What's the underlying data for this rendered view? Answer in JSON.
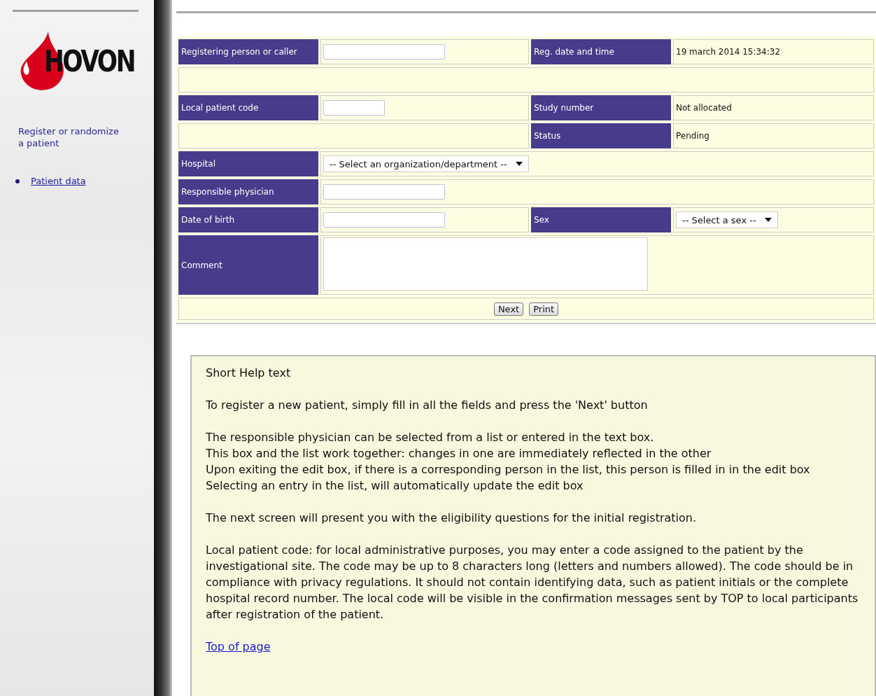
{
  "sidebar": {
    "logo": "HOVON",
    "heading": "Register or randomize a patient",
    "links": [
      {
        "label": "Patient data"
      }
    ]
  },
  "form": {
    "registering_person": {
      "label": "Registering person or caller"
    },
    "reg_date": {
      "label": "Reg. date and time",
      "value": "19 march 2014 15:34:32"
    },
    "local_code": {
      "label": "Local patient code"
    },
    "study_number": {
      "label": "Study number",
      "value": "Not allocated"
    },
    "status": {
      "label": "Status",
      "value": "Pending"
    },
    "hospital": {
      "label": "Hospital",
      "value": "-- Select an organization/department --"
    },
    "physician": {
      "label": "Responsible physician"
    },
    "birth_date": {
      "label": "Date of birth"
    },
    "sex": {
      "label": "Sex",
      "value": "-- Select a sex --"
    },
    "comment": {
      "label": "Comment"
    },
    "buttons": [
      "Next",
      "Print"
    ]
  },
  "help": {
    "title": "Short Help text",
    "paragraphs": [
      [
        "To register a new patient, simply fill in all the fields and press the 'Next' button"
      ],
      [
        "The responsible physician can be selected from a list or entered in the text box.",
        "This box and the list work together: changes in one are immediately reflected in the other",
        "Upon exiting the edit box, if there is a corresponding person in the list, this person is filled in in the edit box",
        "Selecting an entry in the list, will automatically update the edit box"
      ],
      [
        "The next screen will present you with the eligibility questions for the initial registration."
      ],
      [
        "Local patient code: for local administrative purposes, you may enter a code assigned to the patient by the investigational site. The code may be up to 8 characters long (letters and numbers allowed). The code should be in compliance with privacy regulations. It should not contain identifying data, such as patient initials or the complete hospital record number. The local code will be visible in the confirmation messages sent by TOP to local participants after registration of the patient."
      ]
    ],
    "link": "Top of page"
  }
}
